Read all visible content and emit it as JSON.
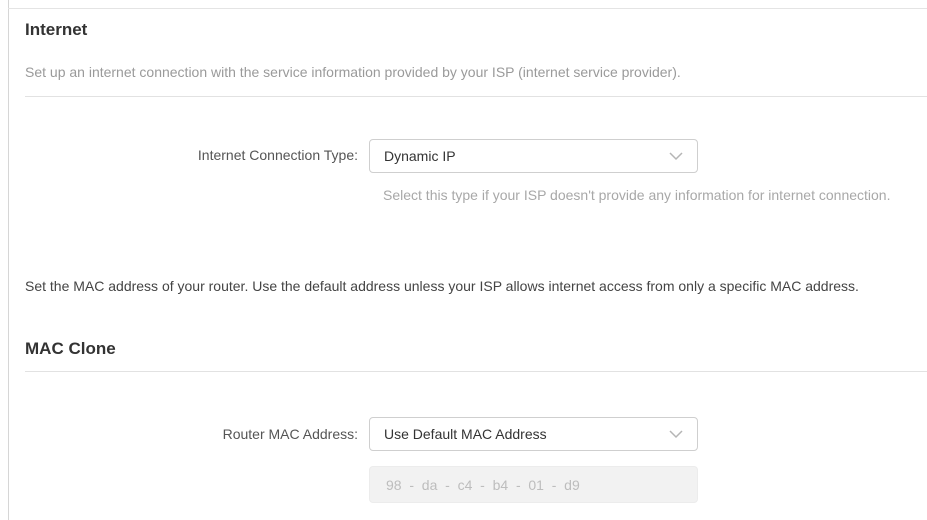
{
  "internet": {
    "title": "Internet",
    "description": "Set up an internet connection with the service information provided by your ISP (internet service provider).",
    "connection_type_label": "Internet Connection Type:",
    "connection_type_value": "Dynamic IP",
    "connection_type_hint": "Select this type if your ISP doesn't provide any information for internet connection."
  },
  "mac": {
    "intro": "Set the MAC address of your router. Use the default address unless your ISP allows internet access from only a specific MAC address.",
    "title": "MAC Clone",
    "router_mac_label": "Router MAC Address:",
    "router_mac_value": "Use Default MAC Address",
    "mac_address_display": "98  -  da  -  c4  -  b4  -  01  -  d9"
  },
  "icons": {
    "dropdown": "chevron-down-icon"
  },
  "colors": {
    "title": "#333333",
    "muted_text": "#9a9a9a",
    "border": "#cfcfcf",
    "disabled_bg": "#f2f2f2"
  }
}
